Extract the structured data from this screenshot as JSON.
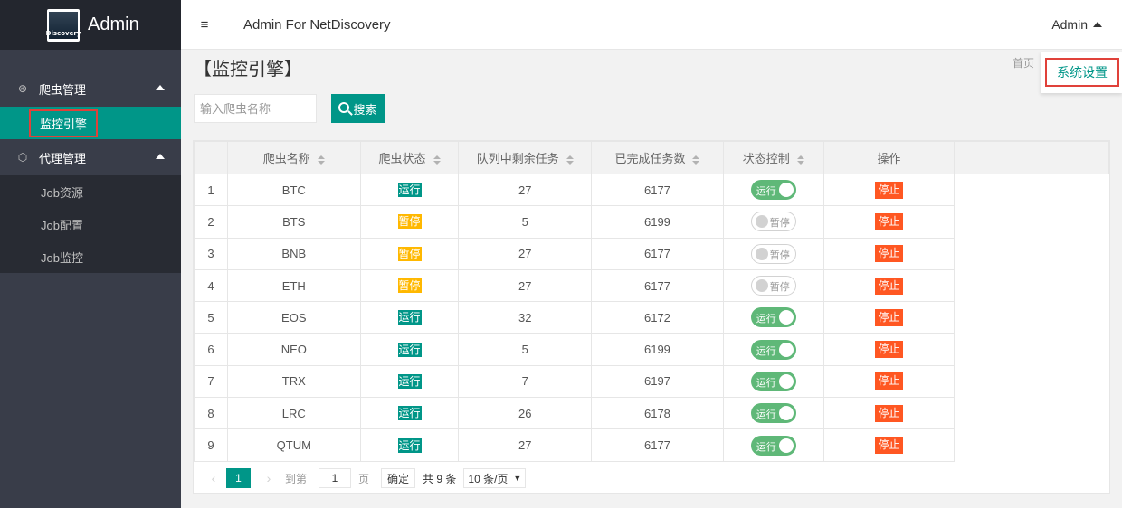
{
  "sidebar": {
    "brand_title": "Admin",
    "logo_text": "Discovery",
    "groups": [
      {
        "label": "爬虫管理",
        "icon": "spider-icon",
        "items": [
          {
            "label": "监控引擎",
            "active": true
          }
        ]
      },
      {
        "label": "代理管理",
        "icon": "cube-icon",
        "items": [
          {
            "label": "Job资源"
          },
          {
            "label": "Job配置"
          },
          {
            "label": "Job监控"
          }
        ]
      }
    ]
  },
  "header": {
    "menu_icon": "hamburger-icon",
    "title": "Admin For NetDiscovery",
    "user": "Admin"
  },
  "dropdown": {
    "item": "系统设置"
  },
  "breadcrumb": "首页",
  "page": {
    "title": "【监控引擎】",
    "search_placeholder": "输入爬虫名称",
    "search_button": "搜索"
  },
  "table": {
    "headers": [
      "",
      "爬虫名称",
      "爬虫状态",
      "队列中剩余任务",
      "已完成任务数",
      "状态控制",
      "操作"
    ],
    "rows": [
      {
        "no": "1",
        "name": "BTC",
        "status": "运行",
        "running": true,
        "remaining": "27",
        "done": "6177",
        "switch": "运行",
        "action": "停止"
      },
      {
        "no": "2",
        "name": "BTS",
        "status": "暂停",
        "running": false,
        "remaining": "5",
        "done": "6199",
        "switch": "暂停",
        "action": "停止"
      },
      {
        "no": "3",
        "name": "BNB",
        "status": "暂停",
        "running": false,
        "remaining": "27",
        "done": "6177",
        "switch": "暂停",
        "action": "停止"
      },
      {
        "no": "4",
        "name": "ETH",
        "status": "暂停",
        "running": false,
        "remaining": "27",
        "done": "6177",
        "switch": "暂停",
        "action": "停止"
      },
      {
        "no": "5",
        "name": "EOS",
        "status": "运行",
        "running": true,
        "remaining": "32",
        "done": "6172",
        "switch": "运行",
        "action": "停止"
      },
      {
        "no": "6",
        "name": "NEO",
        "status": "运行",
        "running": true,
        "remaining": "5",
        "done": "6199",
        "switch": "运行",
        "action": "停止"
      },
      {
        "no": "7",
        "name": "TRX",
        "status": "运行",
        "running": true,
        "remaining": "7",
        "done": "6197",
        "switch": "运行",
        "action": "停止"
      },
      {
        "no": "8",
        "name": "LRC",
        "status": "运行",
        "running": true,
        "remaining": "26",
        "done": "6178",
        "switch": "运行",
        "action": "停止"
      },
      {
        "no": "9",
        "name": "QTUM",
        "status": "运行",
        "running": true,
        "remaining": "27",
        "done": "6177",
        "switch": "运行",
        "action": "停止"
      }
    ]
  },
  "pager": {
    "current": "1",
    "goto_label": "到第",
    "goto_value": "1",
    "page_unit": "页",
    "confirm": "确定",
    "total": "共 9 条",
    "page_size": "10 条/页"
  },
  "colors": {
    "accent": "#009688",
    "pause": "#ffb800",
    "danger": "#ff5722",
    "switch_on": "#5fb878",
    "sidebar": "#393d49"
  }
}
